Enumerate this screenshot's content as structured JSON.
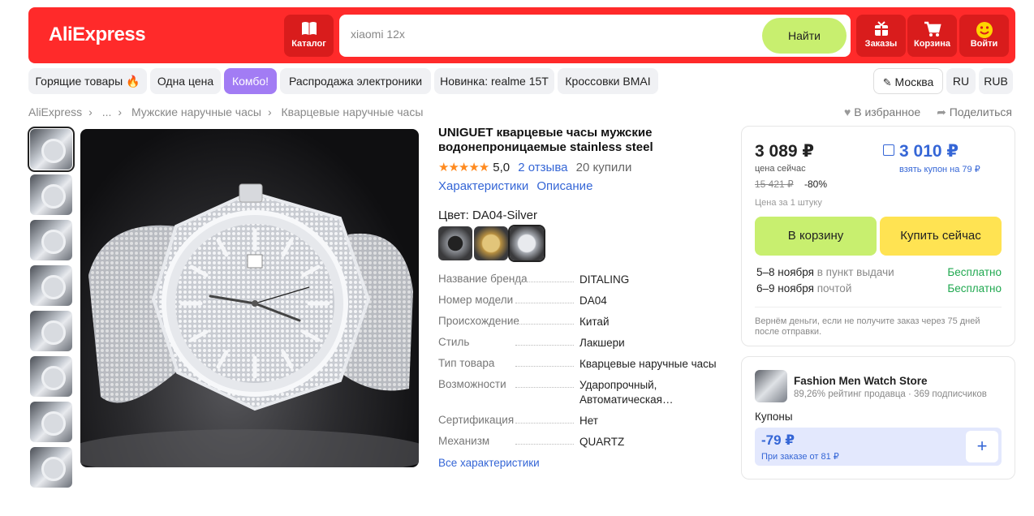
{
  "header": {
    "logo": "AliExpress",
    "catalog_label": "Каталог",
    "search_value": "xiaomi 12x",
    "search_button": "Найти",
    "orders_label": "Заказы",
    "cart_label": "Корзина",
    "login_label": "Войти",
    "accent": "#ff2a2a"
  },
  "chips": [
    "Горящие товары 🔥",
    "Одна цена",
    "Комбо!",
    "Распродажа электроники",
    "Новинка: realme 15T",
    "Кроссовки BMAI"
  ],
  "locale": {
    "city": "Москва",
    "lang": "RU",
    "currency": "RUB"
  },
  "breadcrumb": [
    "AliExpress",
    "...",
    "Мужские наручные часы",
    "Кварцевые наручные часы"
  ],
  "actions": {
    "favorite": "В избранное",
    "share": "Поделиться"
  },
  "product": {
    "title": "UNIGUET кварцевые часы мужские водонепроницаемые stainless steel",
    "stars": "★★★★★",
    "rating": "5,0",
    "reviews": "2 отзыва",
    "sold": "20 купили",
    "link_specs": "Характеристики",
    "link_desc": "Описание",
    "color_label": "Цвет: DA04-Silver",
    "specs": [
      {
        "k": "Название бренда",
        "v": "DITALING"
      },
      {
        "k": "Номер модели",
        "v": "DA04"
      },
      {
        "k": "Происхождение",
        "v": "Китай"
      },
      {
        "k": "Стиль",
        "v": "Лакшери"
      },
      {
        "k": "Тип товара",
        "v": "Кварцевые наручные часы"
      },
      {
        "k": "Возможности",
        "v": "Ударопрочный, Автоматическая…"
      },
      {
        "k": "Сертификация",
        "v": "Нет"
      },
      {
        "k": "Механизм",
        "v": "QUARTZ"
      }
    ],
    "all_specs": "Все характеристики"
  },
  "buy": {
    "price": "3 089 ₽",
    "price_label": "цена сейчас",
    "old_price": "15 421 ₽",
    "discount": "-80%",
    "unit": "Цена за 1 штуку",
    "coupon_price": "3 010 ₽",
    "coupon_label": "взять купон на 79 ₽",
    "cart_button": "В корзину",
    "buy_button": "Купить сейчас",
    "delivery": [
      {
        "date": "5–8 ноября",
        "where": "в пункт выдачи",
        "price": "Бесплатно"
      },
      {
        "date": "6–9 ноября",
        "where": "почтой",
        "price": "Бесплатно"
      }
    ],
    "note": "Вернём деньги, если не получите заказ через 75 дней после отправки."
  },
  "store": {
    "name": "Fashion Men Watch Store",
    "rating": "89,26% рейтинг продавца",
    "subs": "369 подписчиков",
    "coupons_label": "Купоны",
    "coupon_amount": "-79 ₽",
    "coupon_min": "При заказе от 81 ₽"
  }
}
